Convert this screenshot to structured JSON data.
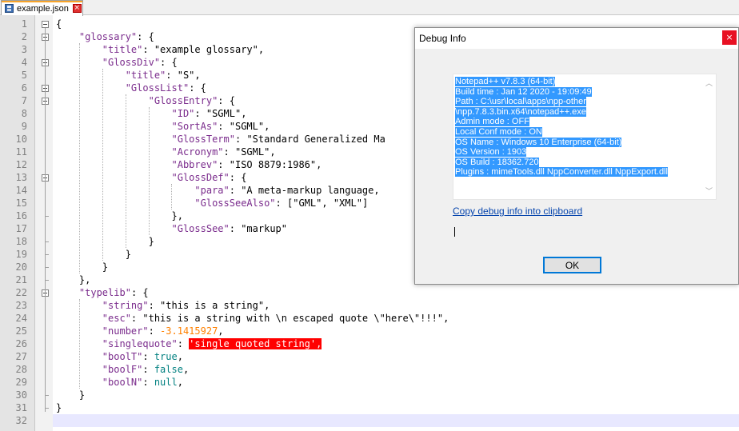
{
  "tab": {
    "filename": "example.json",
    "close_glyph": "×",
    "icon": "save-icon"
  },
  "editor": {
    "current_line": 32,
    "lines": [
      {
        "n": "1",
        "tokens": [
          {
            "t": "p",
            "v": "{"
          }
        ]
      },
      {
        "n": "2",
        "tokens": [
          {
            "t": "p",
            "v": "    "
          },
          {
            "t": "k",
            "v": "\"glossary\""
          },
          {
            "t": "p",
            "v": ": {"
          }
        ]
      },
      {
        "n": "3",
        "tokens": [
          {
            "t": "p",
            "v": "        "
          },
          {
            "t": "k",
            "v": "\"title\""
          },
          {
            "t": "p",
            "v": ": "
          },
          {
            "t": "s",
            "v": "\"example glossary\""
          },
          {
            "t": "p",
            "v": ","
          }
        ]
      },
      {
        "n": "4",
        "tokens": [
          {
            "t": "p",
            "v": "        "
          },
          {
            "t": "k",
            "v": "\"GlossDiv\""
          },
          {
            "t": "p",
            "v": ": {"
          }
        ]
      },
      {
        "n": "5",
        "tokens": [
          {
            "t": "p",
            "v": "            "
          },
          {
            "t": "k",
            "v": "\"title\""
          },
          {
            "t": "p",
            "v": ": "
          },
          {
            "t": "s",
            "v": "\"S\""
          },
          {
            "t": "p",
            "v": ","
          }
        ]
      },
      {
        "n": "6",
        "tokens": [
          {
            "t": "p",
            "v": "            "
          },
          {
            "t": "k",
            "v": "\"GlossList\""
          },
          {
            "t": "p",
            "v": ": {"
          }
        ]
      },
      {
        "n": "7",
        "tokens": [
          {
            "t": "p",
            "v": "                "
          },
          {
            "t": "k",
            "v": "\"GlossEntry\""
          },
          {
            "t": "p",
            "v": ": {"
          }
        ]
      },
      {
        "n": "8",
        "tokens": [
          {
            "t": "p",
            "v": "                    "
          },
          {
            "t": "k",
            "v": "\"ID\""
          },
          {
            "t": "p",
            "v": ": "
          },
          {
            "t": "s",
            "v": "\"SGML\""
          },
          {
            "t": "p",
            "v": ","
          }
        ]
      },
      {
        "n": "9",
        "tokens": [
          {
            "t": "p",
            "v": "                    "
          },
          {
            "t": "k",
            "v": "\"SortAs\""
          },
          {
            "t": "p",
            "v": ": "
          },
          {
            "t": "s",
            "v": "\"SGML\""
          },
          {
            "t": "p",
            "v": ","
          }
        ]
      },
      {
        "n": "10",
        "tokens": [
          {
            "t": "p",
            "v": "                    "
          },
          {
            "t": "k",
            "v": "\"GlossTerm\""
          },
          {
            "t": "p",
            "v": ": "
          },
          {
            "t": "s",
            "v": "\"Standard Generalized Ma"
          }
        ]
      },
      {
        "n": "11",
        "tokens": [
          {
            "t": "p",
            "v": "                    "
          },
          {
            "t": "k",
            "v": "\"Acronym\""
          },
          {
            "t": "p",
            "v": ": "
          },
          {
            "t": "s",
            "v": "\"SGML\""
          },
          {
            "t": "p",
            "v": ","
          }
        ]
      },
      {
        "n": "12",
        "tokens": [
          {
            "t": "p",
            "v": "                    "
          },
          {
            "t": "k",
            "v": "\"Abbrev\""
          },
          {
            "t": "p",
            "v": ": "
          },
          {
            "t": "s",
            "v": "\"ISO 8879:1986\""
          },
          {
            "t": "p",
            "v": ","
          }
        ]
      },
      {
        "n": "13",
        "tokens": [
          {
            "t": "p",
            "v": "                    "
          },
          {
            "t": "k",
            "v": "\"GlossDef\""
          },
          {
            "t": "p",
            "v": ": {"
          }
        ]
      },
      {
        "n": "14",
        "tokens": [
          {
            "t": "p",
            "v": "                        "
          },
          {
            "t": "k",
            "v": "\"para\""
          },
          {
            "t": "p",
            "v": ": "
          },
          {
            "t": "s",
            "v": "\"A meta-markup language,"
          }
        ]
      },
      {
        "n": "15",
        "tokens": [
          {
            "t": "p",
            "v": "                        "
          },
          {
            "t": "k",
            "v": "\"GlossSeeAlso\""
          },
          {
            "t": "p",
            "v": ": ["
          },
          {
            "t": "s",
            "v": "\"GML\""
          },
          {
            "t": "p",
            "v": ", "
          },
          {
            "t": "s",
            "v": "\"XML\""
          },
          {
            "t": "p",
            "v": "]"
          }
        ]
      },
      {
        "n": "16",
        "tokens": [
          {
            "t": "p",
            "v": "                    },"
          }
        ]
      },
      {
        "n": "17",
        "tokens": [
          {
            "t": "p",
            "v": "                    "
          },
          {
            "t": "k",
            "v": "\"GlossSee\""
          },
          {
            "t": "p",
            "v": ": "
          },
          {
            "t": "s",
            "v": "\"markup\""
          }
        ]
      },
      {
        "n": "18",
        "tokens": [
          {
            "t": "p",
            "v": "                }"
          }
        ]
      },
      {
        "n": "19",
        "tokens": [
          {
            "t": "p",
            "v": "            }"
          }
        ]
      },
      {
        "n": "20",
        "tokens": [
          {
            "t": "p",
            "v": "        }"
          }
        ]
      },
      {
        "n": "21",
        "tokens": [
          {
            "t": "p",
            "v": "    },"
          }
        ]
      },
      {
        "n": "22",
        "tokens": [
          {
            "t": "p",
            "v": "    "
          },
          {
            "t": "k",
            "v": "\"typelib\""
          },
          {
            "t": "p",
            "v": ": {"
          }
        ]
      },
      {
        "n": "23",
        "tokens": [
          {
            "t": "p",
            "v": "        "
          },
          {
            "t": "k",
            "v": "\"string\""
          },
          {
            "t": "p",
            "v": ": "
          },
          {
            "t": "s",
            "v": "\"this is a string\""
          },
          {
            "t": "p",
            "v": ","
          }
        ]
      },
      {
        "n": "24",
        "tokens": [
          {
            "t": "p",
            "v": "        "
          },
          {
            "t": "k",
            "v": "\"esc\""
          },
          {
            "t": "p",
            "v": ": "
          },
          {
            "t": "s",
            "v": "\"this is a string with \\n escaped quote \\\"here\\\"!!!\""
          },
          {
            "t": "p",
            "v": ","
          }
        ]
      },
      {
        "n": "25",
        "tokens": [
          {
            "t": "p",
            "v": "        "
          },
          {
            "t": "k",
            "v": "\"number\""
          },
          {
            "t": "p",
            "v": ": "
          },
          {
            "t": "n",
            "v": "-3.1415927"
          },
          {
            "t": "p",
            "v": ","
          }
        ]
      },
      {
        "n": "26",
        "tokens": [
          {
            "t": "p",
            "v": "        "
          },
          {
            "t": "k",
            "v": "\"singlequote\""
          },
          {
            "t": "p",
            "v": ": "
          },
          {
            "t": "err",
            "v": "'single quoted string',"
          }
        ]
      },
      {
        "n": "27",
        "tokens": [
          {
            "t": "p",
            "v": "        "
          },
          {
            "t": "k",
            "v": "\"boolT\""
          },
          {
            "t": "p",
            "v": ": "
          },
          {
            "t": "b",
            "v": "true"
          },
          {
            "t": "p",
            "v": ","
          }
        ]
      },
      {
        "n": "28",
        "tokens": [
          {
            "t": "p",
            "v": "        "
          },
          {
            "t": "k",
            "v": "\"boolF\""
          },
          {
            "t": "p",
            "v": ": "
          },
          {
            "t": "b",
            "v": "false"
          },
          {
            "t": "p",
            "v": ","
          }
        ]
      },
      {
        "n": "29",
        "tokens": [
          {
            "t": "p",
            "v": "        "
          },
          {
            "t": "k",
            "v": "\"boolN\""
          },
          {
            "t": "p",
            "v": ": "
          },
          {
            "t": "b",
            "v": "null"
          },
          {
            "t": "p",
            "v": ","
          }
        ]
      },
      {
        "n": "30",
        "tokens": [
          {
            "t": "p",
            "v": "    }"
          }
        ]
      },
      {
        "n": "31",
        "tokens": [
          {
            "t": "p",
            "v": "}"
          }
        ]
      },
      {
        "n": "32",
        "tokens": []
      }
    ]
  },
  "dialog": {
    "title": "Debug Info",
    "close_glyph": "×",
    "info_lines": [
      "Notepad++ v7.8.3   (64-bit)",
      "Build time : Jan 12 2020 - 19:09:49",
      "Path : C:\\usr\\local\\apps\\npp-other",
      "\\npp.7.8.3.bin.x64\\notepad++.exe",
      "Admin mode : OFF",
      "Local Conf mode : ON",
      "OS Name : Windows 10 Enterprise (64-bit)",
      "OS Version : 1903",
      "OS Build : 18362.720",
      "Plugins : mimeTools.dll NppConverter.dll NppExport.dll"
    ],
    "copy_link": "Copy debug info into clipboard",
    "ok_label": "OK"
  },
  "colors": {
    "key": "#7a2b8c",
    "number": "#ff8000",
    "boolean": "#008080",
    "error_bg": "#ff0000",
    "selection": "#3399ff",
    "current_line": "#e8e8ff"
  }
}
